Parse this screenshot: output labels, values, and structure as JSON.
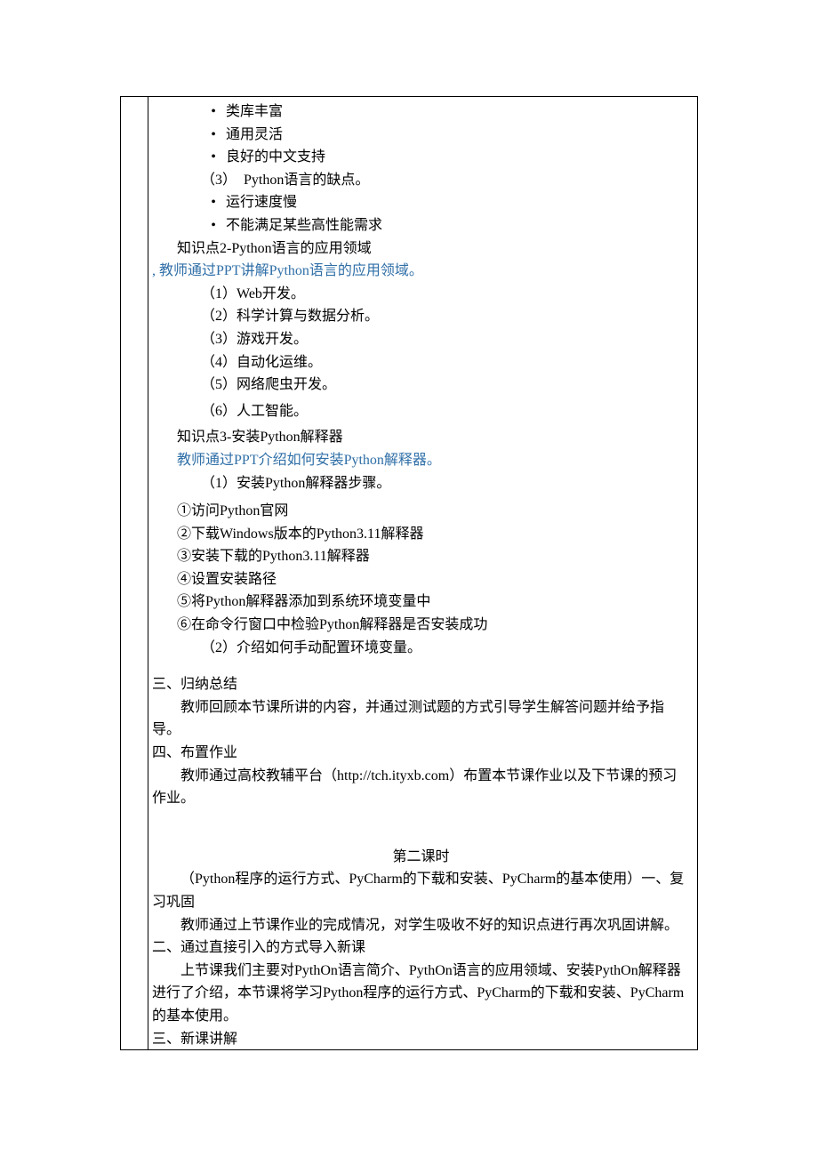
{
  "bullets1": [
    "类库丰富",
    "通用灵活",
    "良好的中文支持"
  ],
  "num3": "（3）　Python语言的缺点。",
  "bullets2": [
    "运行速度慢",
    "不能满足某些高性能需求"
  ],
  "kp2_title": "知识点2-Python语言的应用领域",
  "kp2_note": ", 教师通过PPT讲解Python语言的应用领域。",
  "kp2_items": [
    "（1）Web开发。",
    "（2）科学计算与数据分析。",
    "（3）游戏开发。",
    "（4）自动化运维。",
    "（5）网络爬虫开发。",
    "（6）人工智能。"
  ],
  "kp3_title": "知识点3-安装Python解释器",
  "kp3_note": "教师通过PPT介绍如何安装Python解释器。",
  "kp3_step_label": "（1）安装Python解释器步骤。",
  "kp3_steps": [
    "①访问Python官网",
    "②下载Windows版本的Python3.11解释器",
    "③安装下载的Python3.11解释器",
    "④设置安装路径",
    "⑤将Python解释器添加到系统环境变量中",
    "⑥在命令行窗口中检验Python解释器是否安装成功"
  ],
  "kp3_env": "（2）介绍如何手动配置环境变量。",
  "sec3_title": "三、归纳总结",
  "sec3_body": "教师回顾本节课所讲的内容，并通过测试题的方式引导学生解答问题并给予指导。",
  "sec4_title": "四、布置作业",
  "sec4_body": "教师通过高校教辅平台（http://tch.ityxb.com）布置本节课作业以及下节课的预习作业。",
  "lesson2_title": "第二课时",
  "lesson2_intro": "（Python程序的运行方式、PyCharm的下载和安装、PyCharm的基本使用）一、复习巩固",
  "lesson2_review": "教师通过上节课作业的完成情况，对学生吸收不好的知识点进行再次巩固讲解。",
  "lesson2_sec2_title": "二、通过直接引入的方式导入新课",
  "lesson2_sec2_body": "上节课我们主要对PythOn语言简介、PythOn语言的应用领域、安装PythOn解释器进行了介绍，本节课将学习Python程序的运行方式、PyCharm的下载和安装、PyCharm的基本使用。",
  "lesson2_sec3_title": "三、新课讲解"
}
